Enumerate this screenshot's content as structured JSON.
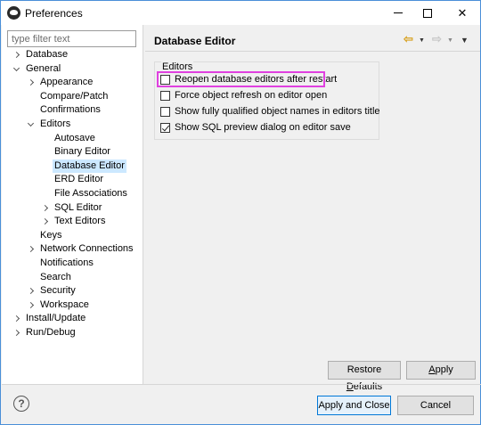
{
  "window": {
    "title": "Preferences",
    "controls": {
      "minimize": "—",
      "maximize": "□",
      "close": "✕"
    }
  },
  "sidebar": {
    "filter_placeholder": "type filter text",
    "items": [
      {
        "label": "Database",
        "expander": "right"
      },
      {
        "label": "General",
        "expander": "down"
      },
      {
        "label": "Appearance",
        "expander": "right"
      },
      {
        "label": "Compare/Patch",
        "expander": "none"
      },
      {
        "label": "Confirmations",
        "expander": "none"
      },
      {
        "label": "Editors",
        "expander": "down"
      },
      {
        "label": "Autosave",
        "expander": "none"
      },
      {
        "label": "Binary Editor",
        "expander": "none"
      },
      {
        "label": "Database Editor",
        "expander": "none",
        "selected": true
      },
      {
        "label": "ERD Editor",
        "expander": "none"
      },
      {
        "label": "File Associations",
        "expander": "none"
      },
      {
        "label": "SQL Editor",
        "expander": "right"
      },
      {
        "label": "Text Editors",
        "expander": "right"
      },
      {
        "label": "Keys",
        "expander": "none"
      },
      {
        "label": "Network Connections",
        "expander": "right"
      },
      {
        "label": "Notifications",
        "expander": "none"
      },
      {
        "label": "Search",
        "expander": "none"
      },
      {
        "label": "Security",
        "expander": "right"
      },
      {
        "label": "Workspace",
        "expander": "right"
      },
      {
        "label": "Install/Update",
        "expander": "right"
      },
      {
        "label": "Run/Debug",
        "expander": "right"
      }
    ]
  },
  "page": {
    "title": "Database Editor",
    "nav": {
      "back": "⇦",
      "back_dropdown": "▼",
      "forward": "⇨",
      "forward_dropdown": "▼",
      "menu": "▼"
    },
    "group_title": "Editors",
    "options": [
      {
        "label": "Reopen database editors after restart",
        "checked": false
      },
      {
        "label": "Force object refresh on editor open",
        "checked": false
      },
      {
        "label": "Show fully qualified object names in editors title",
        "checked": false
      },
      {
        "label": "Show SQL preview dialog on editor save",
        "checked": true
      }
    ],
    "restore_defaults_pre": "Restore ",
    "restore_defaults_u": "D",
    "restore_defaults_post": "efaults",
    "apply_pre": "",
    "apply_u": "A",
    "apply_post": "pply"
  },
  "footer": {
    "help": "?",
    "apply_close_label": "Apply and Close",
    "cancel_label": "Cancel"
  },
  "colors": {
    "selection": "#cce8ff",
    "highlight_box": "#e040e0",
    "default_button_border": "#0078d7"
  }
}
